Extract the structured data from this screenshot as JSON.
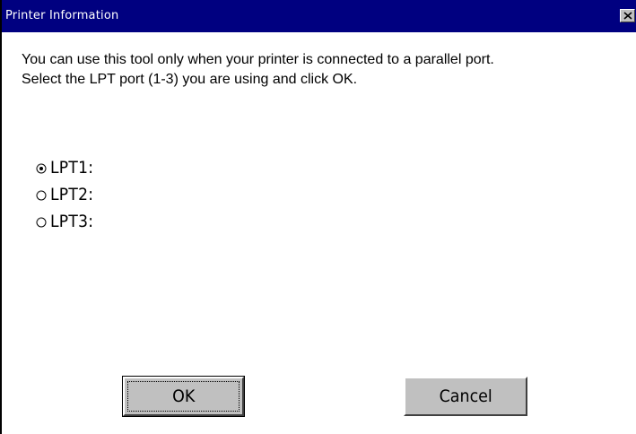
{
  "window": {
    "title": "Printer Information",
    "close_icon": "close-icon"
  },
  "message": {
    "line1": "You can use this tool only when your printer is connected to a parallel port.",
    "line2": "Select the LPT port (1-3) you are using and click OK."
  },
  "ports": {
    "selected": "LPT1:",
    "options": [
      {
        "label": "LPT1:",
        "checked": true
      },
      {
        "label": "LPT2:",
        "checked": false
      },
      {
        "label": "LPT3:",
        "checked": false
      }
    ]
  },
  "buttons": {
    "ok_label": "OK",
    "cancel_label": "Cancel"
  },
  "colors": {
    "titlebar": "#000080",
    "button_face": "#c0c0c0"
  }
}
